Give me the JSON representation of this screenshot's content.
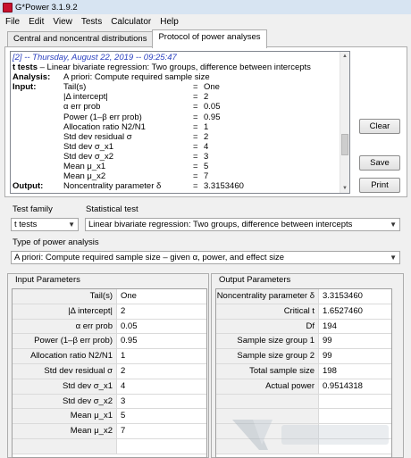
{
  "window": {
    "title": "G*Power 3.1.9.2"
  },
  "menu": [
    "File",
    "Edit",
    "View",
    "Tests",
    "Calculator",
    "Help"
  ],
  "tabs": [
    {
      "label": "Central and noncentral distributions",
      "active": false
    },
    {
      "label": "Protocol of power analyses",
      "active": true
    }
  ],
  "protocol": {
    "header": "[2] -- Thursday, August 22, 2019 -- 09:25:47",
    "test_bold": "t tests",
    "test_rest": " – Linear bivariate regression: Two groups, difference between intercepts",
    "analysis_label": "Analysis:",
    "analysis_value": "A priori: Compute required sample size",
    "rows": [
      {
        "section": "Input:",
        "name": "Tail(s)",
        "eq": "=",
        "value": "One"
      },
      {
        "section": "",
        "name": "|Δ intercept|",
        "eq": "=",
        "value": "2"
      },
      {
        "section": "",
        "name": "α err prob",
        "eq": "=",
        "value": "0.05"
      },
      {
        "section": "",
        "name": "Power (1–β err prob)",
        "eq": "=",
        "value": "0.95"
      },
      {
        "section": "",
        "name": "Allocation ratio N2/N1",
        "eq": "=",
        "value": "1"
      },
      {
        "section": "",
        "name": "Std dev residual σ",
        "eq": "=",
        "value": "2"
      },
      {
        "section": "",
        "name": "Std dev σ_x1",
        "eq": "=",
        "value": "4"
      },
      {
        "section": "",
        "name": "Std dev σ_x2",
        "eq": "=",
        "value": "3"
      },
      {
        "section": "",
        "name": "Mean μ_x1",
        "eq": "=",
        "value": "5"
      },
      {
        "section": "",
        "name": "Mean μ_x2",
        "eq": "=",
        "value": "7"
      },
      {
        "section": "Output:",
        "name": "Noncentrality parameter δ",
        "eq": "=",
        "value": "3.3153460"
      }
    ]
  },
  "buttons": {
    "clear": "Clear",
    "save": "Save",
    "print": "Print"
  },
  "test_family": {
    "label": "Test family",
    "value": "t tests"
  },
  "statistical_test": {
    "label": "Statistical test",
    "value": "Linear bivariate regression: Two groups, difference between intercepts"
  },
  "power_analysis": {
    "label": "Type of power analysis",
    "value": "A priori: Compute required sample size – given α, power, and effect size"
  },
  "input_params": {
    "title": "Input Parameters",
    "rows": [
      {
        "label": "Tail(s)",
        "value": "One"
      },
      {
        "label": "|Δ intercept|",
        "value": "2"
      },
      {
        "label": "α err prob",
        "value": "0.05"
      },
      {
        "label": "Power (1–β err prob)",
        "value": "0.95"
      },
      {
        "label": "Allocation ratio N2/N1",
        "value": "1"
      },
      {
        "label": "Std dev residual σ",
        "value": "2"
      },
      {
        "label": "Std dev σ_x1",
        "value": "4"
      },
      {
        "label": "Std dev σ_x2",
        "value": "3"
      },
      {
        "label": "Mean μ_x1",
        "value": "5"
      },
      {
        "label": "Mean μ_x2",
        "value": "7"
      }
    ]
  },
  "output_params": {
    "title": "Output Parameters",
    "rows": [
      {
        "label": "Noncentrality parameter δ",
        "value": "3.3153460"
      },
      {
        "label": "Critical t",
        "value": "1.6527460"
      },
      {
        "label": "Df",
        "value": "194"
      },
      {
        "label": "Sample size group 1",
        "value": "99"
      },
      {
        "label": "Sample size group 2",
        "value": "99"
      },
      {
        "label": "Total sample size",
        "value": "198"
      },
      {
        "label": "Actual power",
        "value": "0.9514318"
      }
    ]
  }
}
